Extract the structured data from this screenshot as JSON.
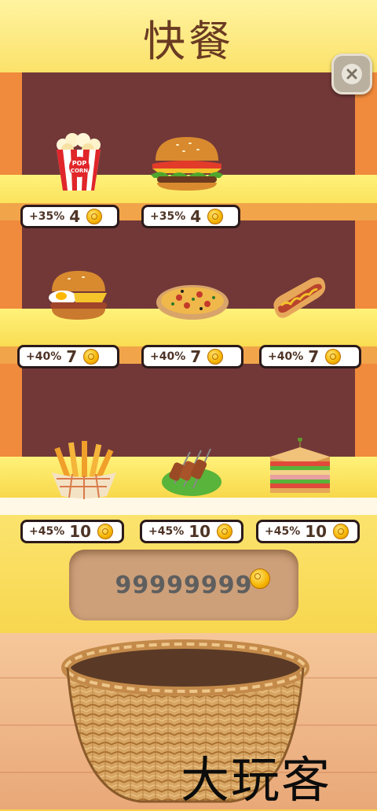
{
  "title": "快餐",
  "close_button": {
    "icon": "close-icon"
  },
  "shelves": [
    {
      "items": [
        {
          "name": "popcorn",
          "icon": "popcorn-icon",
          "bonus": "+35%",
          "price": "4",
          "label": "POP CORN"
        },
        {
          "name": "hamburger",
          "icon": "hamburger-icon",
          "bonus": "+35%",
          "price": "4"
        }
      ]
    },
    {
      "items": [
        {
          "name": "egg-burger",
          "icon": "egg-burger-icon",
          "bonus": "+40%",
          "price": "7"
        },
        {
          "name": "pizza",
          "icon": "pizza-icon",
          "bonus": "+40%",
          "price": "7"
        },
        {
          "name": "hotdog",
          "icon": "hotdog-icon",
          "bonus": "+40%",
          "price": "7"
        }
      ]
    },
    {
      "items": [
        {
          "name": "fries",
          "icon": "fries-icon",
          "bonus": "+45%",
          "price": "10"
        },
        {
          "name": "kebab",
          "icon": "kebab-icon",
          "bonus": "+45%",
          "price": "10"
        },
        {
          "name": "sandwich",
          "icon": "sandwich-icon",
          "bonus": "+45%",
          "price": "10"
        }
      ]
    }
  ],
  "money": {
    "value": "99999999",
    "icon": "coin-icon"
  },
  "basket": {
    "icon": "basket-icon"
  },
  "watermark": "大玩客",
  "colors": {
    "shelf_back": "#723838",
    "shelf_board": "#f8d84a",
    "frame": "#f08a3c",
    "title": "#6a3b22"
  }
}
